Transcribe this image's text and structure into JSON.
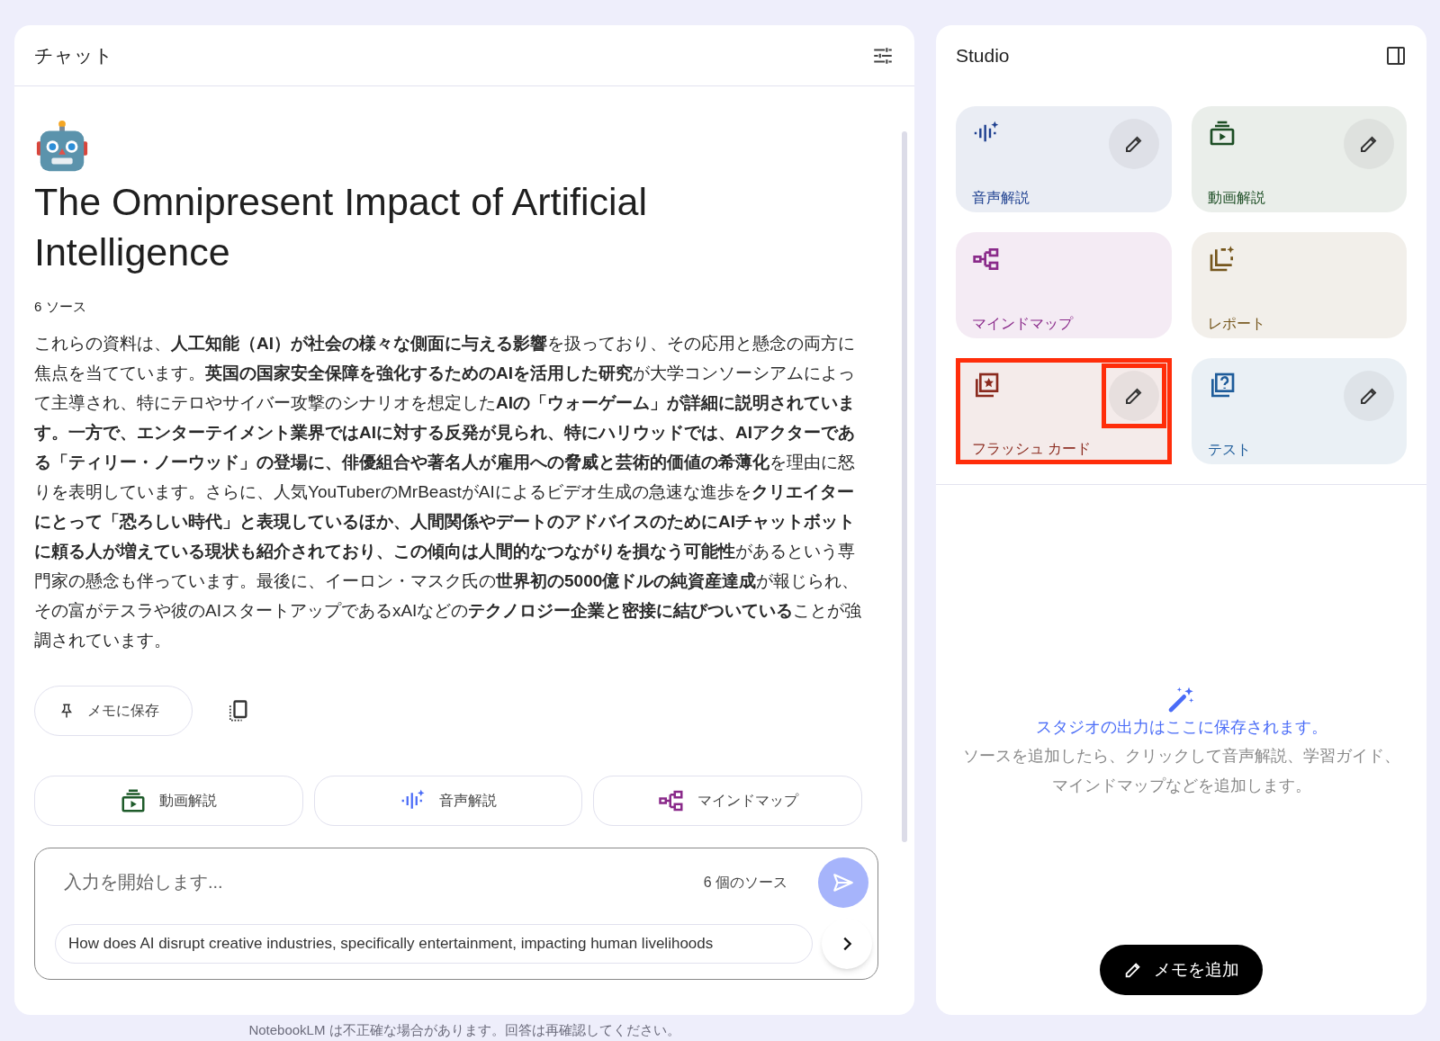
{
  "chat": {
    "title": "チャット",
    "note": {
      "title": "The Omnipresent Impact of Artificial Intelligence",
      "source_count": "6 ソース",
      "summary": "これらの資料は、**人工知能（AI）が社会の様々な側面に与える影響**を扱っており、その応用と懸念の両方に焦点を当てています。**英国の国家安全保障を強化するためのAIを活用した研究**が大学コンソーシアムによって主導され、特にテロやサイバー攻撃のシナリオを想定した**AIの「ウォーゲーム」が詳細に説明されています。一方で、エンターテイメント業界ではAIに対する反発が見られ、特にハリウッドでは、AIアクターである「ティリー・ノーウッド」の登場に、俳優組合や著名人が雇用への脅威と芸術的価値の希薄化**を理由に怒りを表明しています。さらに、人気YouTuberのMrBeastがAIによるビデオ生成の急速な進歩を**クリエイターにとって「恐ろしい時代」と表現しているほか、人間関係やデートのアドバイスのためにAIチャットボットに頼る人が増えている現状も紹介されており、この傾向は人間的なつながりを損なう可能性**があるという専門家の懸念も伴っています。最後に、イーロン・マスク氏の**世界初の5000億ドルの純資産達成**が報じられ、その富がテスラや彼のAIスタートアップであるxAIなどの**テクノロジー企業と密接に結びついている**ことが強調されています。",
      "save_button": "メモに保存"
    },
    "chips": [
      {
        "kind": "video",
        "label": "動画解説",
        "color": "#1e5b2a"
      },
      {
        "kind": "audio",
        "label": "音声解説",
        "color": "#4a6cf7"
      },
      {
        "kind": "mindmap",
        "label": "マインドマップ",
        "color": "#8a2a8a"
      }
    ],
    "input": {
      "placeholder": "入力を開始します...",
      "source_count": "6 個のソース"
    },
    "suggestion": "How does AI disrupt creative industries, specifically entertainment, impacting human livelihoods"
  },
  "studio": {
    "title": "Studio",
    "tiles": [
      {
        "kind": "audio",
        "label": "音声解説",
        "color": "#1d3f8f",
        "editable": true,
        "highlighted": false
      },
      {
        "kind": "video",
        "label": "動画解説",
        "color": "#1c4d24",
        "editable": true,
        "highlighted": false
      },
      {
        "kind": "mindmap",
        "label": "マインドマップ",
        "color": "#8a2a8a",
        "editable": false,
        "highlighted": false
      },
      {
        "kind": "report",
        "label": "レポート",
        "color": "#75561c",
        "editable": false,
        "highlighted": false
      },
      {
        "kind": "flashcard",
        "label": "フラッシュ カード",
        "color": "#8a2a1e",
        "editable": true,
        "highlighted": true
      },
      {
        "kind": "quiz",
        "label": "テスト",
        "color": "#1e5c9a",
        "editable": true,
        "highlighted": false
      }
    ],
    "empty_title": "スタジオの出力はここに保存されます。",
    "empty_text": "ソースを追加したら、クリックして音声解説、学習ガイド、マインドマップなどを追加します。",
    "add_note_button": "メモを追加"
  },
  "disclaimer": "NotebookLM は不正確な場合があります。回答は再確認してください。"
}
